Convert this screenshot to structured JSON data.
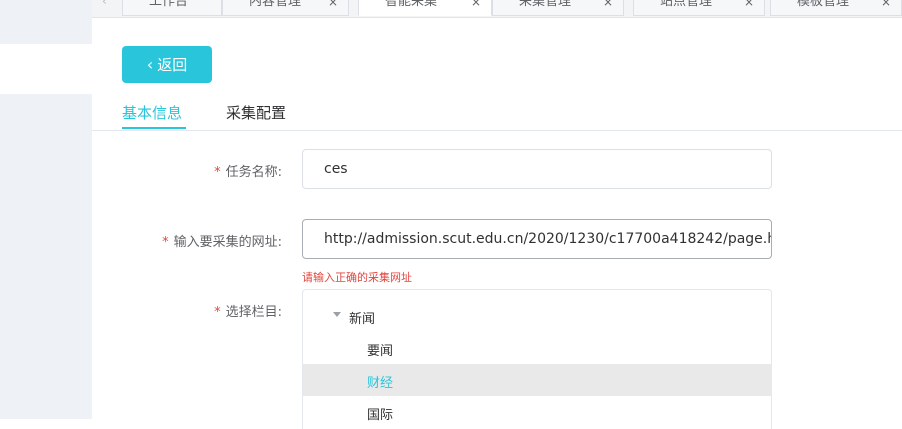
{
  "tabs": [
    {
      "label": "工作台",
      "closable": false
    },
    {
      "label": "内容管理",
      "closable": true
    },
    {
      "label": "智能采集",
      "closable": true,
      "active": true
    },
    {
      "label": "采集管理",
      "closable": true
    },
    {
      "label": "站点管理",
      "closable": true
    },
    {
      "label": "模板管理",
      "closable": true
    }
  ],
  "back_label": "返回",
  "subtabs": {
    "basic": "基本信息",
    "config": "采集配置"
  },
  "form": {
    "task_name_label": "任务名称:",
    "task_name_value": "ces",
    "url_label": "输入要采集的网址:",
    "url_value": "http://admission.scut.edu.cn/2020/1230/c17700a418242/page.h",
    "url_error": "请输入正确的采集网址",
    "column_label": "选择栏目:"
  },
  "tree": {
    "root": "新闻",
    "children": [
      "要闻",
      "财经",
      "国际"
    ],
    "selected": "财经"
  },
  "colors": {
    "accent": "#29c6db",
    "required": "#e0463c"
  }
}
